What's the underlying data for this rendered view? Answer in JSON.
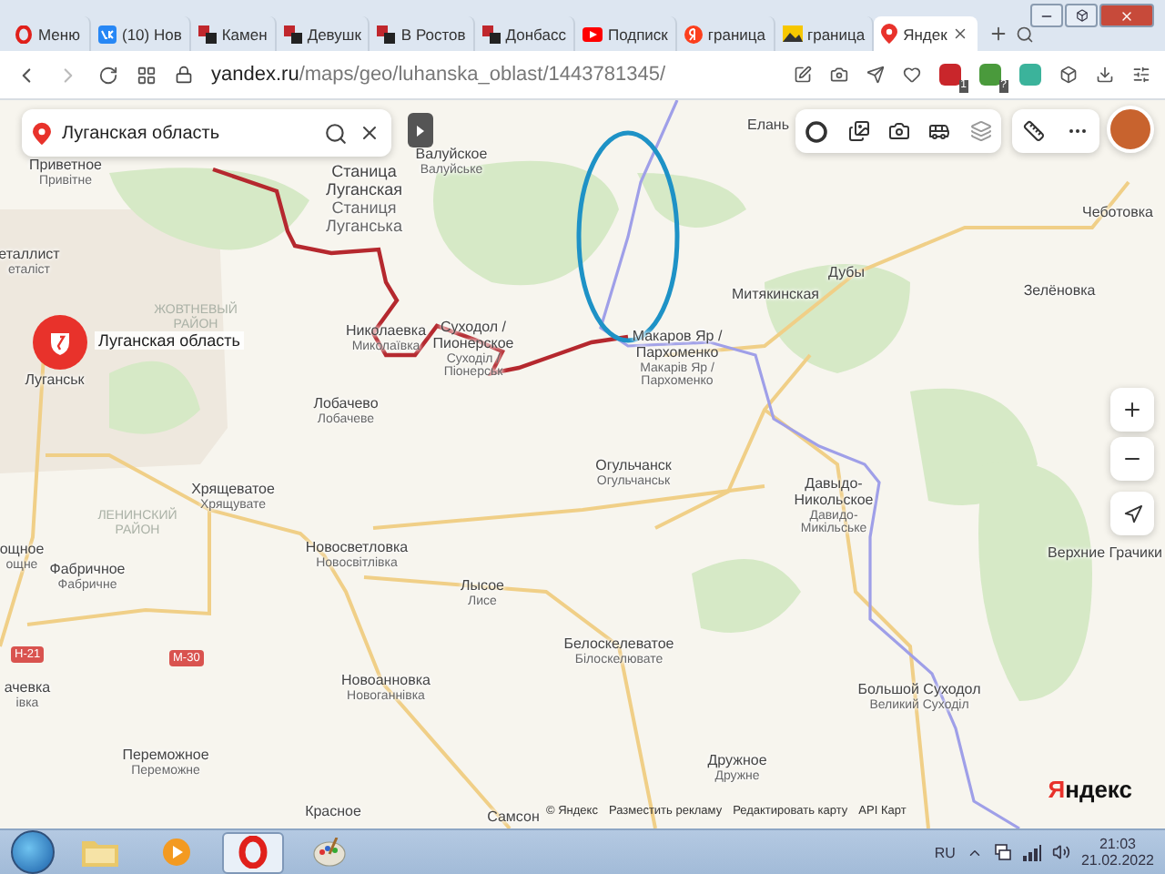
{
  "browser": {
    "tabs": [
      {
        "label": "Меню",
        "kind": "menu",
        "selected": false
      },
      {
        "label": "(10) Нов",
        "kind": "vk",
        "selected": false
      },
      {
        "label": "Камен",
        "kind": "forum",
        "selected": false
      },
      {
        "label": "Девушк",
        "kind": "forum",
        "selected": false
      },
      {
        "label": "В Ростов",
        "kind": "forum",
        "selected": false
      },
      {
        "label": "Донбасс",
        "kind": "forum",
        "selected": false
      },
      {
        "label": "Подписк",
        "kind": "video",
        "selected": false
      },
      {
        "label": "граница",
        "kind": "search",
        "selected": false
      },
      {
        "label": "граница",
        "kind": "image",
        "selected": false
      },
      {
        "label": "Яндек",
        "kind": "maps",
        "selected": true
      }
    ],
    "address": {
      "host": "yandex.ru",
      "path": "/maps/geo/luhanska_oblast/1443781345/"
    },
    "extension_badges": [
      "1",
      "?"
    ]
  },
  "map": {
    "search": {
      "value": "Луганская область"
    },
    "marker_label": "Луганская область",
    "districts": [
      "ЖОВТНЕВЫЙ РАЙОН",
      "ЛЕНИНСКИЙ РАЙОН"
    ],
    "places": [
      {
        "name": "Елань"
      },
      {
        "name": "Приветное",
        "alt": "Привітне"
      },
      {
        "name": "Станица Луганская",
        "alt": "Станиця Луганська"
      },
      {
        "name": "Валуйское",
        "alt": "Валуйське"
      },
      {
        "name": "Чеботовка"
      },
      {
        "name": "еталлист",
        "alt": "еталіст"
      },
      {
        "name": "Дубы"
      },
      {
        "name": "Митякинская"
      },
      {
        "name": "Зелёновка"
      },
      {
        "name": "Луганськ"
      },
      {
        "name": "Николаевка",
        "alt": "Миколаївка"
      },
      {
        "name": "Суходол / Пионерское",
        "alt": "Суходіл / Піонерськ"
      },
      {
        "name": "Макаров Яр / Пархоменко",
        "alt": "Макарів Яр / Пархоменко"
      },
      {
        "name": "Лобачево",
        "alt": "Лобачеве"
      },
      {
        "name": "Хрящеватое",
        "alt": "Хрящувате"
      },
      {
        "name": "Огульчанск",
        "alt": "Огульчанськ"
      },
      {
        "name": "ощное",
        "alt": "ощне"
      },
      {
        "name": "Фабричное",
        "alt": "Фабричне"
      },
      {
        "name": "Новосветловка",
        "alt": "Новосвітлівка"
      },
      {
        "name": "Давыдо-Никольское",
        "alt": "Давидо-Микільське"
      },
      {
        "name": "Верхние Грачики"
      },
      {
        "name": "Лысое",
        "alt": "Лисе"
      },
      {
        "name": "Белоскелеватое",
        "alt": "Білоскелювате"
      },
      {
        "name": "ачевка",
        "alt": "івка"
      },
      {
        "name": "Новоанновка",
        "alt": "Новоганнівка"
      },
      {
        "name": "Большой Суходол",
        "alt": "Великий Суходіл"
      },
      {
        "name": "Переможное",
        "alt": "Переможне"
      },
      {
        "name": "Дружное",
        "alt": "Дружне"
      },
      {
        "name": "Красное"
      },
      {
        "name": "Самсон"
      }
    ],
    "road_signs": [
      "Н-21",
      "М-30"
    ],
    "footer": [
      "© Яндекс",
      "Разместить рекламу",
      "Редактировать карту",
      "API Карт"
    ],
    "logo": "Яндекс"
  },
  "taskbar": {
    "apps": [
      {
        "kind": "folder",
        "selected": false
      },
      {
        "kind": "player",
        "selected": false
      },
      {
        "kind": "opera",
        "selected": true
      },
      {
        "kind": "paint",
        "selected": false
      }
    ],
    "language": "RU",
    "time": "21:03",
    "date": "21.02.2022"
  }
}
